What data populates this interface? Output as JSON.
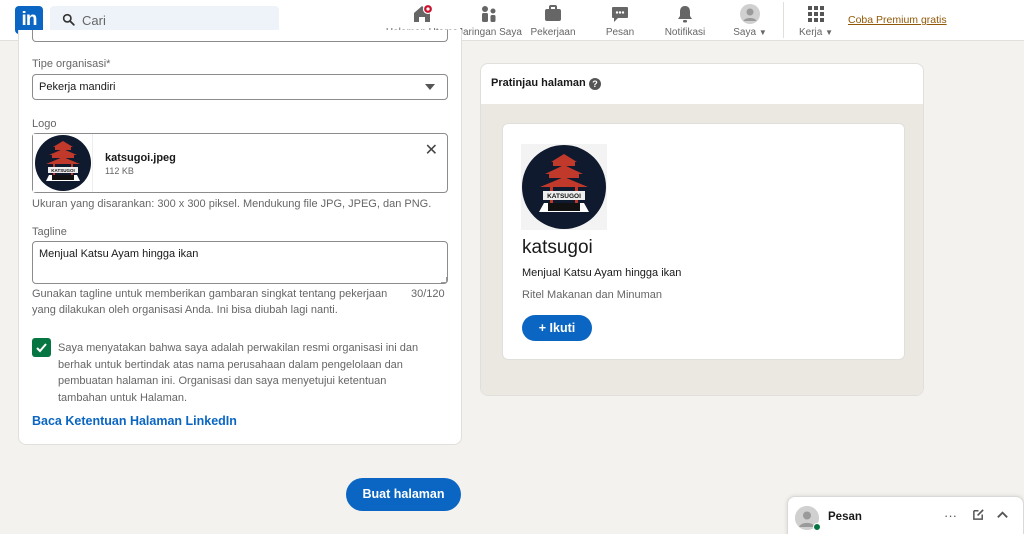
{
  "nav": {
    "logo": "in",
    "search_placeholder": "Cari",
    "items": [
      {
        "label": "Halaman Utama"
      },
      {
        "label": "Jaringan Saya"
      },
      {
        "label": "Pekerjaan"
      },
      {
        "label": "Pesan"
      },
      {
        "label": "Notifikasi"
      },
      {
        "label": "Saya"
      },
      {
        "label": "Kerja"
      }
    ],
    "premium": "Coba Premium gratis"
  },
  "form": {
    "org_type_label": "Tipe organisasi*",
    "org_type_value": "Pekerja mandiri",
    "logo_label": "Logo",
    "logo_filename": "katsugoi.jpeg",
    "logo_filesize": "112 KB",
    "logo_hint": "Ukuran yang disarankan: 300 x 300 piksel. Mendukung file JPG, JPEG, dan PNG.",
    "tagline_label": "Tagline",
    "tagline_value": "Menjual Katsu Ayam hingga ikan",
    "tagline_hint_1": "Gunakan tagline untuk memberikan gambaran singkat tentang pekerjaan",
    "tagline_hint_2": "yang dilakukan oleh organisasi Anda. Ini bisa diubah lagi nanti.",
    "tagline_count": "30/120",
    "consent_text": "Saya menyatakan bahwa saya adalah perwakilan resmi organisasi ini dan berhak untuk bertindak atas nama perusahaan dalam pengelolaan dan pembuatan halaman ini. Organisasi dan saya menyetujui ketentuan tambahan untuk Halaman.",
    "terms_link": "Baca Ketentuan Halaman LinkedIn",
    "create_button": "Buat halaman"
  },
  "preview": {
    "title": "Pratinjau halaman",
    "help": "?",
    "org_name": "katsugoi",
    "tagline": "Menjual Katsu Ayam hingga ikan",
    "industry": "Ritel Makanan dan Minuman",
    "follow_button": "+ Ikuti",
    "logo_text": "KATSUGOI"
  },
  "messaging": {
    "label": "Pesan"
  },
  "colors": {
    "brand": "#0a66c2",
    "check": "#057642",
    "background": "#f4f2ee",
    "notification": "#cb112d"
  }
}
